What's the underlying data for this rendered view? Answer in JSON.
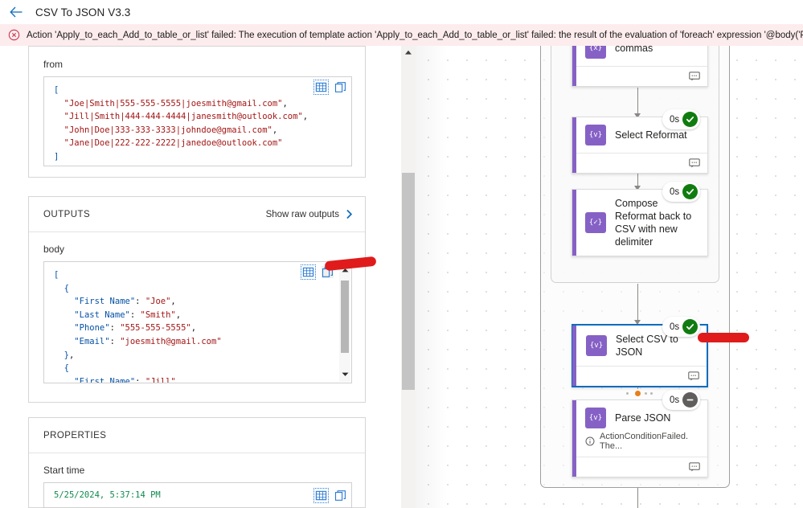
{
  "header": {
    "back_icon": "back-arrow-icon",
    "title": "CSV To JSON V3.3"
  },
  "error_banner": {
    "icon": "error-circle-icon",
    "message": "Action 'Apply_to_each_Add_to_table_or_list' failed: The execution of template action 'Apply_to_each_Add_to_table_or_list' failed: the result of the evaluation of 'foreach' expression '@body('Parse_JSON')' is of type 'Null'.'"
  },
  "details": {
    "from": {
      "label": "from",
      "table_icon": "table-view-icon",
      "copy_icon": "copy-icon",
      "lines": [
        "[",
        "  \"Joe|Smith|555-555-5555|joesmith@gmail.com\",",
        "  \"Jill|Smith|444-444-4444|janesmith@outlook.com\",",
        "  \"John|Doe|333-333-3333|johndoe@gmail.com\",",
        "  \"Jane|Doe|222-222-2222|janedoe@outlook.com\"",
        "]"
      ]
    },
    "outputs": {
      "section_title": "OUTPUTS",
      "show_raw_label": "Show raw outputs",
      "chevron_icon": "chevron-right-icon",
      "body_label": "body",
      "table_icon": "table-view-icon",
      "copy_icon": "copy-icon",
      "scroll_up_icon": "scroll-up-icon",
      "scroll_down_icon": "scroll-down-icon",
      "lines": [
        "[",
        "  {",
        "    \"First Name\": \"Joe\",",
        "    \"Last Name\": \"Smith\",",
        "    \"Phone\": \"555-555-5555\",",
        "    \"Email\": \"joesmith@gmail.com\"",
        "  },",
        "  {",
        "    \"First Name\": \"Jill\","
      ]
    },
    "properties": {
      "section_title": "PROPERTIES",
      "start_time_label": "Start time",
      "start_time_value": "5/25/2024, 5:37:14 PM",
      "table_icon": "table-view-icon",
      "copy_icon": "copy-icon"
    }
  },
  "designer": {
    "scroll_up_icon": "scroll-up-icon",
    "comment_icon": "comment-icon",
    "warning_icon": "info-circle-icon",
    "check_icon": "check-mark-icon",
    "skipped_icon": "dash-icon",
    "nodes": [
      {
        "title": "commas",
        "icon": "expression-icon",
        "icon_glyph": "{x}",
        "duration": "",
        "status": "",
        "has_footer": true
      },
      {
        "title": "Select Reformat",
        "icon": "expression-icon",
        "icon_glyph": "{v}",
        "duration": "0s",
        "status": "succeeded",
        "has_footer": true
      },
      {
        "title": "Compose Reformat back to CSV with new delimiter",
        "icon": "expression-icon",
        "icon_glyph": "{✓}",
        "duration": "0s",
        "status": "succeeded",
        "has_footer": false
      },
      {
        "title": "Select CSV to JSON",
        "icon": "expression-icon",
        "icon_glyph": "{v}",
        "duration": "0s",
        "status": "succeeded",
        "selected": true,
        "has_footer": true
      },
      {
        "title": "Parse JSON",
        "icon": "expression-icon",
        "icon_glyph": "{v}",
        "duration": "0s",
        "status": "skipped",
        "subtitle": "ActionConditionFailed. The...",
        "has_footer": true
      }
    ]
  },
  "annotations": [
    {
      "name": "annotation-stroke-outputs-copy"
    },
    {
      "name": "annotation-stroke-selected-node"
    }
  ],
  "colors": {
    "accent_purple": "#8661c5",
    "accent_purple_light": "#b49cdf",
    "link_blue": "#0f6cbd",
    "selection_blue": "#0f6cbd",
    "success_green": "#107c10",
    "skipped_gray": "#605e5c",
    "error_red": "#c4314b",
    "banner_bg": "#fdeced",
    "annotation_red": "#e01b1b"
  }
}
